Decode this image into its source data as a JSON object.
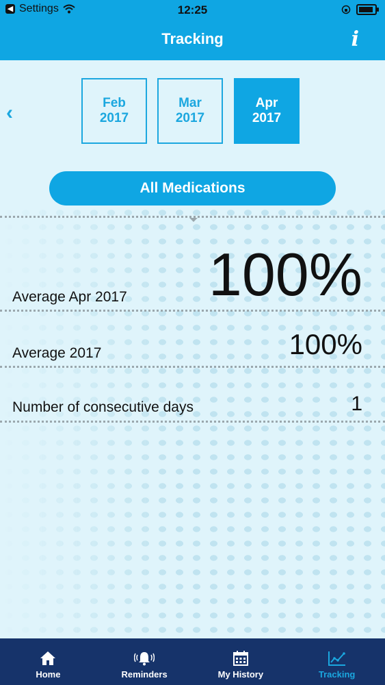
{
  "status_bar": {
    "back_app": "Settings",
    "time": "12:25",
    "battery_level": 0.92
  },
  "header": {
    "title": "Tracking",
    "info_label": "i"
  },
  "month_nav": {
    "prev_arrow": "‹",
    "months": [
      {
        "month": "Feb",
        "year": "2017",
        "active": false
      },
      {
        "month": "Mar",
        "year": "2017",
        "active": false
      },
      {
        "month": "Apr",
        "year": "2017",
        "active": true
      }
    ]
  },
  "filter": {
    "label": "All Medications"
  },
  "stats": [
    {
      "label": "Average Apr 2017",
      "value": "100%"
    },
    {
      "label": "Average 2017",
      "value": "100%"
    },
    {
      "label": "Number of consecutive days",
      "value": "1"
    }
  ],
  "tab_bar": {
    "tabs": [
      {
        "label": "Home",
        "icon": "home-icon",
        "active": false
      },
      {
        "label": "Reminders",
        "icon": "bell-icon",
        "active": false
      },
      {
        "label": "My History",
        "icon": "calendar-icon",
        "active": false
      },
      {
        "label": "Tracking",
        "icon": "chart-icon",
        "active": true
      }
    ]
  },
  "colors": {
    "accent": "#0fa6e3",
    "background": "#dff4fb",
    "tab_bar": "#16336a"
  }
}
